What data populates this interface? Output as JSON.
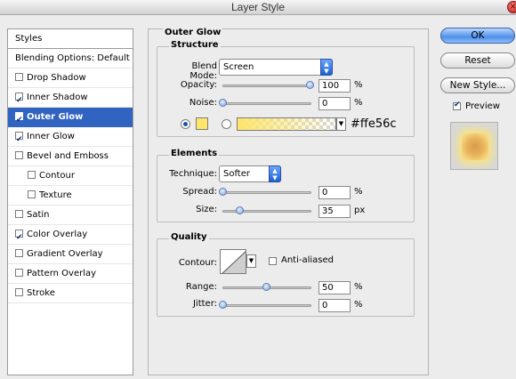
{
  "window": {
    "title": "Layer Style"
  },
  "sidebar": {
    "header": "Styles",
    "items": [
      {
        "label": "Blending Options: Default",
        "checkbox": null,
        "selected": false,
        "sub": false
      },
      {
        "label": "Drop Shadow",
        "checkbox": false,
        "selected": false,
        "sub": false
      },
      {
        "label": "Inner Shadow",
        "checkbox": true,
        "selected": false,
        "sub": false
      },
      {
        "label": "Outer Glow",
        "checkbox": true,
        "selected": true,
        "sub": false
      },
      {
        "label": "Inner Glow",
        "checkbox": true,
        "selected": false,
        "sub": false
      },
      {
        "label": "Bevel and Emboss",
        "checkbox": false,
        "selected": false,
        "sub": false
      },
      {
        "label": "Contour",
        "checkbox": false,
        "selected": false,
        "sub": true
      },
      {
        "label": "Texture",
        "checkbox": false,
        "selected": false,
        "sub": true
      },
      {
        "label": "Satin",
        "checkbox": false,
        "selected": false,
        "sub": false
      },
      {
        "label": "Color Overlay",
        "checkbox": true,
        "selected": false,
        "sub": false
      },
      {
        "label": "Gradient Overlay",
        "checkbox": false,
        "selected": false,
        "sub": false
      },
      {
        "label": "Pattern Overlay",
        "checkbox": false,
        "selected": false,
        "sub": false
      },
      {
        "label": "Stroke",
        "checkbox": false,
        "selected": false,
        "sub": false
      }
    ]
  },
  "panel": {
    "title": "Outer Glow",
    "structure": {
      "title": "Structure",
      "blend_mode_label": "Blend Mode:",
      "blend_mode_value": "Screen",
      "opacity_label": "Opacity:",
      "opacity_value": "100",
      "noise_label": "Noise:",
      "noise_value": "0",
      "percent": "%",
      "color_mode": "solid",
      "color_hex": "#ffe56c",
      "color_hex_text": "#ffe56c"
    },
    "elements": {
      "title": "Elements",
      "technique_label": "Technique:",
      "technique_value": "Softer",
      "spread_label": "Spread:",
      "spread_value": "0",
      "size_label": "Size:",
      "size_value": "35",
      "percent": "%",
      "px": "px"
    },
    "quality": {
      "title": "Quality",
      "contour_label": "Contour:",
      "anti_aliased_label": "Anti-aliased",
      "anti_aliased_checked": false,
      "range_label": "Range:",
      "range_value": "50",
      "jitter_label": "Jitter:",
      "jitter_value": "0",
      "percent": "%"
    }
  },
  "buttons": {
    "ok": "OK",
    "reset": "Reset",
    "new_style": "New Style...",
    "preview_label": "Preview",
    "preview_checked": true
  },
  "colors": {
    "accent": "#3163c1",
    "glow": "#ffe56c"
  }
}
